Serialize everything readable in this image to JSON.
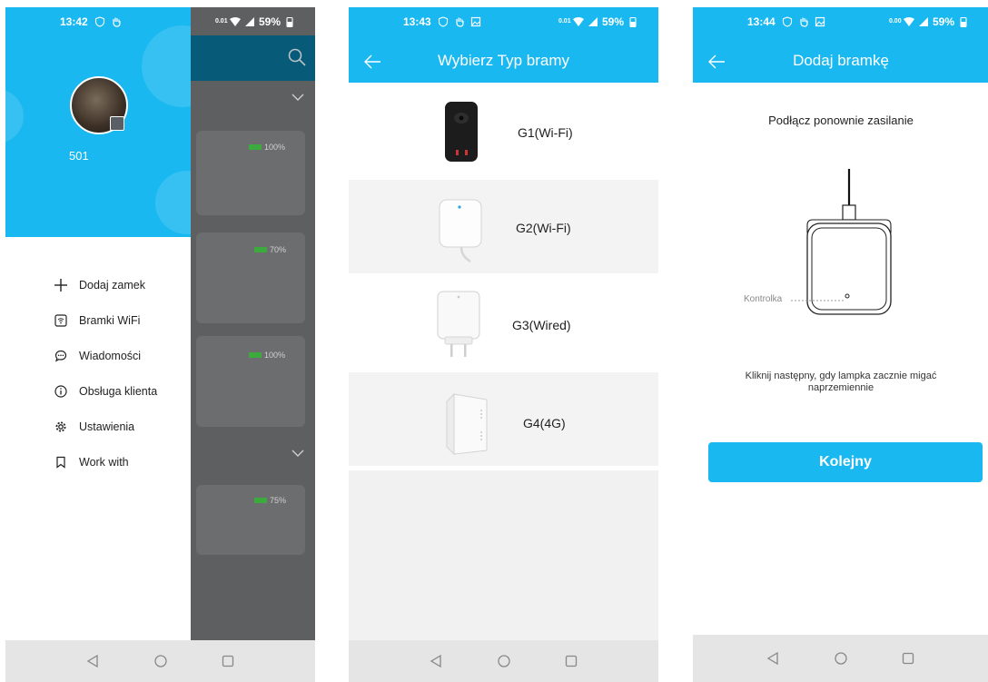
{
  "colors": {
    "accent": "#1ab8f0",
    "scrim": "#5d5f61",
    "scrim_header": "#075a78",
    "battery": "#3caa3c",
    "nav_bar": "#e5e5e5",
    "light_gray": "#f1f1f1"
  },
  "screen1": {
    "status": {
      "time": "13:42",
      "speed": "0.01",
      "battery": "59%"
    },
    "user_id": "501",
    "menu": [
      {
        "icon": "plus-icon",
        "label": "Dodaj zamek"
      },
      {
        "icon": "wifi-gateway-icon",
        "label": "Bramki WiFi"
      },
      {
        "icon": "chat-bubble-icon",
        "label": "Wiadomości"
      },
      {
        "icon": "info-icon",
        "label": "Obsługa klienta"
      },
      {
        "icon": "gear-icon",
        "label": "Ustawienia"
      },
      {
        "icon": "bookmark-icon",
        "label": "Work with"
      }
    ],
    "locks": [
      {
        "battery": "100%"
      },
      {
        "battery": "70%"
      },
      {
        "battery": "100%"
      },
      {
        "battery": "75%"
      }
    ]
  },
  "screen2": {
    "status": {
      "time": "13:43",
      "speed": "0.01",
      "battery": "59%"
    },
    "title": "Wybierz Typ bramy",
    "gateways": [
      {
        "label": "G1(Wi-Fi)"
      },
      {
        "label": "G2(Wi-Fi)"
      },
      {
        "label": "G3(Wired)"
      },
      {
        "label": "G4(4G)"
      }
    ]
  },
  "screen3": {
    "status": {
      "time": "13:44",
      "speed": "0.00",
      "battery": "59%"
    },
    "title": "Dodaj bramkę",
    "instruction": "Podłącz ponownie zasilanie",
    "indicator_label": "Kontrolka",
    "hint": "Kliknij następny, gdy lampka zacznie migać naprzemiennie",
    "next_button": "Kolejny"
  }
}
